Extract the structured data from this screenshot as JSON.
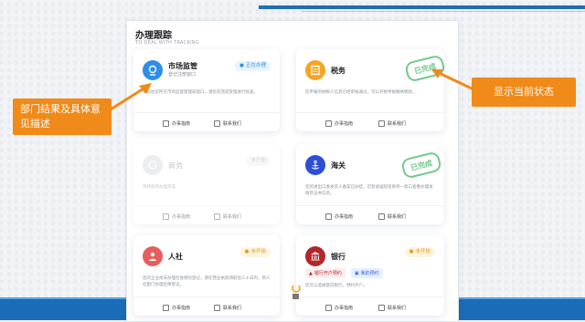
{
  "panel": {
    "title": "办理跟踪",
    "subtitle": "TO DEAL WITH TRACKING"
  },
  "colors": {
    "accent": "#1a6bb8",
    "callout": "#f08a18",
    "stamp": "#5bbf7a"
  },
  "cards": {
    "market": {
      "name": "市场监管",
      "sub": "登记注册窗口",
      "badge": "正在办理",
      "desc": "请前往您所在市场监督管理局窗口，请您先完成受理进行核查。",
      "action_left": "办事指南",
      "action_right": "联系我们"
    },
    "tax": {
      "name": "税务",
      "stamp": "已完成",
      "desc": "您申报的纳税人信息已经审核通过，可以开始申报缴纳税款。",
      "action_left": "办事指南",
      "action_right": "联系我们"
    },
    "commerce": {
      "name": "商务",
      "badge": "未开始",
      "desc": "等待前序办理完成",
      "action_left": "办事指南",
      "action_right": "联系我们"
    },
    "customs": {
      "name": "海关",
      "stamp": "已完成",
      "desc": "您的进出口收发货人备案已办结，可登录国际贸易单一窗口查看办理详情及证书信息。",
      "action_left": "办事指南",
      "action_right": "联系我们"
    },
    "hr": {
      "name": "人社",
      "badge": "未开始",
      "desc": "您的企业尚未办理社会保险登记，请在营业执照领取后三十日内，到人社部门办理社保登记。",
      "action_left": "办事指南",
      "action_right": "联系我们"
    },
    "bank": {
      "name": "银行",
      "badge": "未开始",
      "chip1": "银行开户预约",
      "chip2": "我的预约",
      "desc": "您可以选择意向银行，预约开户。",
      "action_left": "办事指南",
      "action_right": "联系我们"
    }
  },
  "callouts": {
    "left": "部门结果及具体意见描述",
    "right": "显示当前状态"
  }
}
